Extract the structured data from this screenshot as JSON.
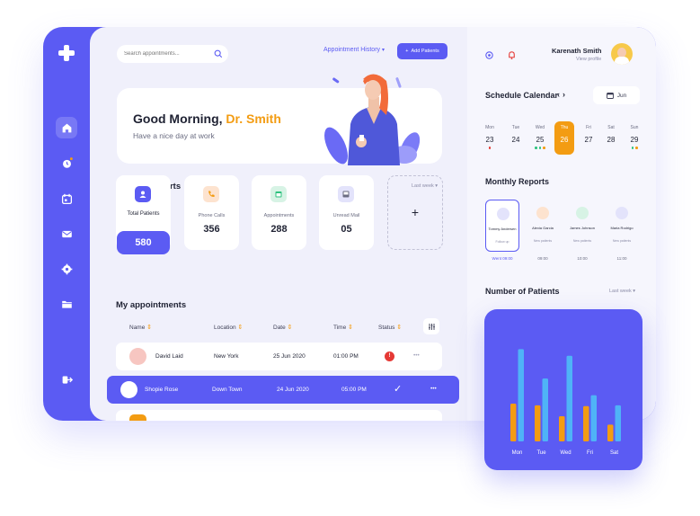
{
  "search": {
    "placeholder": "Search appointments..."
  },
  "header": {
    "history_label": "Appointment History",
    "add_button": "Add Patients"
  },
  "user": {
    "name": "Karenath Smith",
    "profile_link": "View profile"
  },
  "greeting": {
    "prefix": "Good Morning, ",
    "name": "Dr. Smith",
    "subtitle": "Have a nice day at work"
  },
  "weekly": {
    "title": "Weekly Reports",
    "filter": "Last week",
    "cards": [
      {
        "label": "Total Patients",
        "value": "580"
      },
      {
        "label": "Phone Calls",
        "value": "356"
      },
      {
        "label": "Appointments",
        "value": "288"
      },
      {
        "label": "Unread Mail",
        "value": "05"
      }
    ],
    "add_symbol": "+"
  },
  "appointments": {
    "title": "My appointments",
    "headers": [
      "Name",
      "Location",
      "Date",
      "Time",
      "Status"
    ],
    "rows": [
      {
        "name": "David Laid",
        "location": "New York",
        "date": "25 Jun 2020",
        "time": "01:00 PM",
        "status": "!",
        "more": "•••"
      },
      {
        "name": "Shopie Rose",
        "location": "Down Town",
        "date": "24 Jun 2020",
        "time": "05:00 PM",
        "status": "✓",
        "more": "•••"
      }
    ]
  },
  "calendar": {
    "title": "Schedule Calendar",
    "month": "Jun",
    "days": [
      {
        "name": "Mon",
        "date": "23"
      },
      {
        "name": "Tue",
        "date": "24"
      },
      {
        "name": "Wed",
        "date": "25"
      },
      {
        "name": "Thu",
        "date": "26"
      },
      {
        "name": "Fri",
        "date": "27"
      },
      {
        "name": "Sat",
        "date": "28"
      },
      {
        "name": "Sun",
        "date": "29"
      }
    ]
  },
  "monthly": {
    "title": "Monthly Reports",
    "patients": [
      {
        "name": "Tommy Andersen",
        "status": "Follow up",
        "time": "Went 09:00"
      },
      {
        "name": "Alexia Garcia",
        "status": "New patients",
        "time": "09:00"
      },
      {
        "name": "James Johnson",
        "status": "New patients",
        "time": "10:00"
      },
      {
        "name": "Maria Rodrigo",
        "status": "New patients",
        "time": "11:00"
      }
    ]
  },
  "patients_chart_section": {
    "title": "Number of Patients",
    "filter": "Last week"
  },
  "chart_data": {
    "type": "bar",
    "categories": [
      "Mon",
      "Tue",
      "Wed",
      "Fri",
      "Sat"
    ],
    "series": [
      {
        "values": [
          45,
          43,
          30,
          42,
          20
        ]
      },
      {
        "values": [
          110,
          75,
          102,
          55,
          43
        ]
      }
    ],
    "ylim": [
      0,
      120
    ],
    "colors": [
      "#f39c12",
      "#4fb3f7"
    ]
  },
  "colors": {
    "accent": "#5b5bf3",
    "highlight": "#f39c12",
    "alert": "#e53935"
  }
}
